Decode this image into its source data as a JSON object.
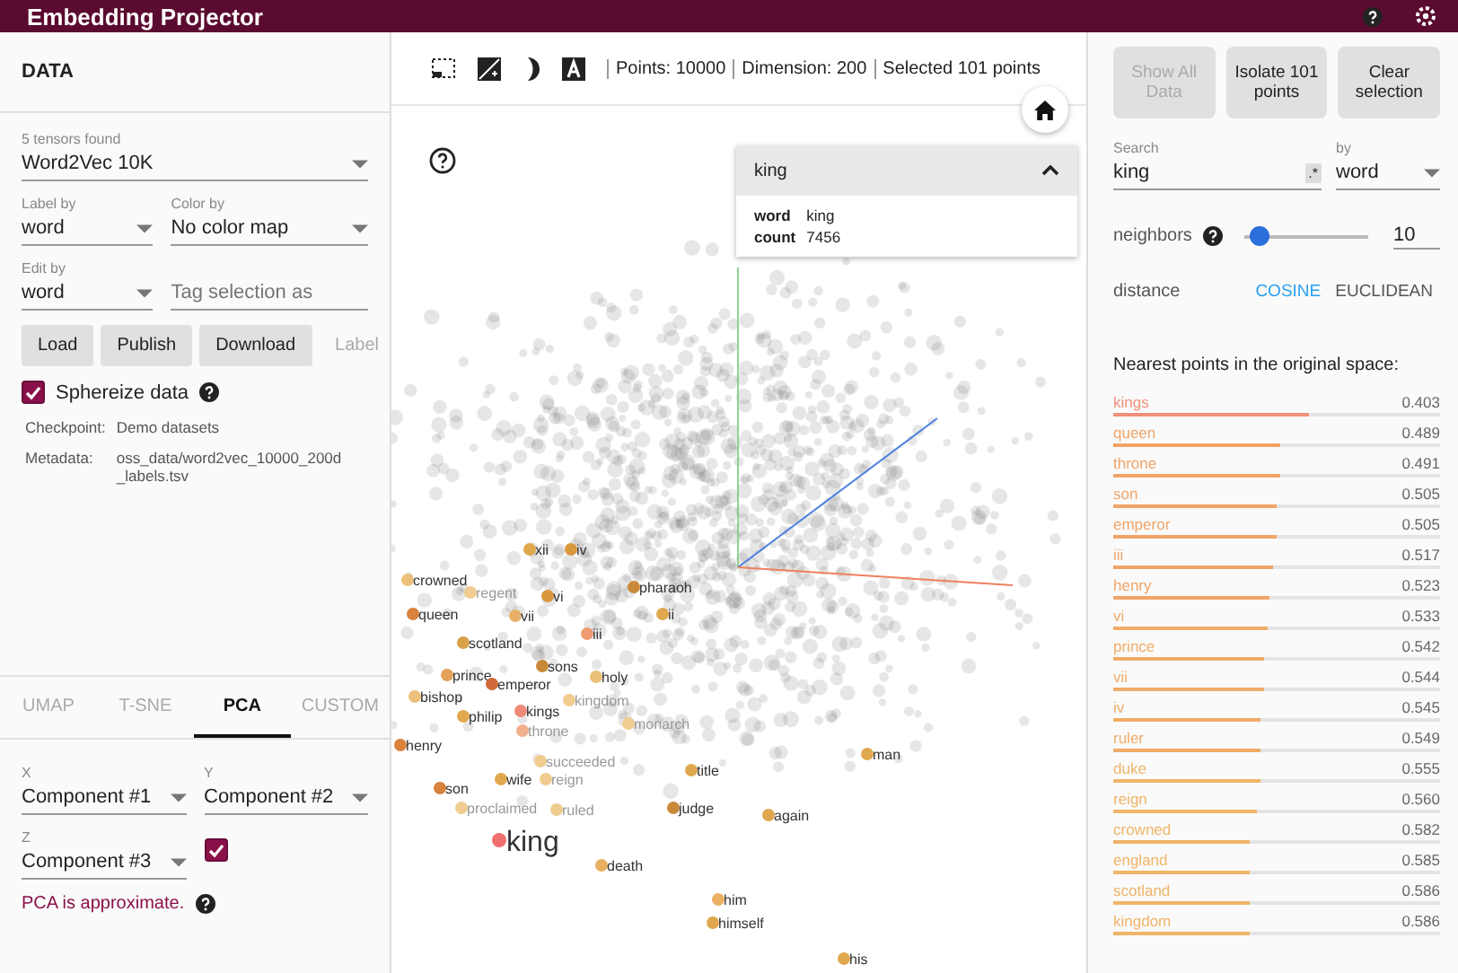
{
  "header": {
    "title": "Embedding Projector"
  },
  "data_panel": {
    "title": "DATA",
    "tensor_select": {
      "label": "5 tensors found",
      "value": "Word2Vec 10K"
    },
    "label_by": {
      "label": "Label by",
      "value": "word"
    },
    "color_by": {
      "label": "Color by",
      "value": "No color map"
    },
    "edit_by": {
      "label": "Edit by",
      "value": "word"
    },
    "tag_field": {
      "placeholder": "Tag selection as"
    },
    "buttons": [
      {
        "label": "Load",
        "disabled": false
      },
      {
        "label": "Publish",
        "disabled": false
      },
      {
        "label": "Download",
        "disabled": false
      },
      {
        "label": "Label",
        "disabled": true
      }
    ],
    "sphereize": {
      "label": "Sphereize data",
      "checked": true
    },
    "checkpoint": {
      "label": "Checkpoint:",
      "value": "Demo datasets"
    },
    "metadata": {
      "label": "Metadata:",
      "value": "oss_data/word2vec_10000_200d_labels.tsv"
    }
  },
  "projection_tabs": [
    {
      "label": "UMAP",
      "selected": false
    },
    {
      "label": "T-SNE",
      "selected": false
    },
    {
      "label": "PCA",
      "selected": true
    },
    {
      "label": "CUSTOM",
      "selected": false
    }
  ],
  "pca": {
    "x": {
      "label": "X",
      "value": "Component #1"
    },
    "y": {
      "label": "Y",
      "value": "Component #2"
    },
    "z": {
      "label": "Z",
      "value": "Component #3"
    },
    "z_enabled": {
      "checked": true
    },
    "note": "PCA is approximate."
  },
  "toolbar": {
    "stats": [
      "Points: 10000",
      "Dimension: 200",
      "Selected 101 points"
    ]
  },
  "inspector_card": {
    "title": "king",
    "expanded": true,
    "fields": [
      {
        "key": "word",
        "value": "king"
      },
      {
        "key": "count",
        "value": "7456"
      }
    ]
  },
  "points": [
    {
      "label": "xii",
      "color": "#e0a84e",
      "faded": false
    },
    {
      "label": "iv",
      "color": "#d9983e",
      "faded": false
    },
    {
      "label": "crowned",
      "color": "#ecc07a",
      "faded": false
    },
    {
      "label": "regent",
      "color": "#f0cc90",
      "faded": true
    },
    {
      "label": "vi",
      "color": "#d9983e",
      "faded": false
    },
    {
      "label": "pharaoh",
      "color": "#c88a3a",
      "faded": false
    },
    {
      "label": "queen",
      "color": "#d8823c",
      "faded": false
    },
    {
      "label": "vii",
      "color": "#e8b06a",
      "faded": false
    },
    {
      "label": "ii",
      "color": "#e0a84e",
      "faded": false
    },
    {
      "label": "iii",
      "color": "#ee9a70",
      "faded": false
    },
    {
      "label": "scotland",
      "color": "#d9a04a",
      "faded": false
    },
    {
      "label": "sons",
      "color": "#c88a3a",
      "faded": false
    },
    {
      "label": "prince",
      "color": "#e3a058",
      "faded": false
    },
    {
      "label": "holy",
      "color": "#ecc07a",
      "faded": false
    },
    {
      "label": "emperor",
      "color": "#d06a3a",
      "faded": false
    },
    {
      "label": "bishop",
      "color": "#ecc07a",
      "faded": false
    },
    {
      "label": "kingdom",
      "color": "#f0cc90",
      "faded": true
    },
    {
      "label": "kings",
      "color": "#f08a7a",
      "faded": false
    },
    {
      "label": "philip",
      "color": "#e3a84e",
      "faded": false
    },
    {
      "label": "monarch",
      "color": "#f0cc90",
      "faded": true
    },
    {
      "label": "throne",
      "color": "#f2b08e",
      "faded": true
    },
    {
      "label": "henry",
      "color": "#d8823c",
      "faded": false
    },
    {
      "label": "man",
      "color": "#e0a84e",
      "faded": false
    },
    {
      "label": "succeeded",
      "color": "#f0cc90",
      "faded": true
    },
    {
      "label": "title",
      "color": "#e0a84e",
      "faded": false
    },
    {
      "label": "wife",
      "color": "#e0a84e",
      "faded": false
    },
    {
      "label": "reign",
      "color": "#f0cc90",
      "faded": true
    },
    {
      "label": "son",
      "color": "#d8823c",
      "faded": false
    },
    {
      "label": "proclaimed",
      "color": "#f0cc90",
      "faded": true
    },
    {
      "label": "ruled",
      "color": "#f0cc90",
      "faded": true
    },
    {
      "label": "judge",
      "color": "#c88a3a",
      "faded": false
    },
    {
      "label": "again",
      "color": "#e0a84e",
      "faded": false
    },
    {
      "label": "king",
      "color": "#f07070",
      "faded": false
    },
    {
      "label": "death",
      "color": "#e8b060",
      "faded": false
    },
    {
      "label": "him",
      "color": "#e8b060",
      "faded": false
    },
    {
      "label": "himself",
      "color": "#e0a84e",
      "faded": false
    },
    {
      "label": "his",
      "color": "#e0a84e",
      "faded": false
    }
  ],
  "right_panel": {
    "buttons": [
      {
        "label": "Show All Data",
        "disabled": true
      },
      {
        "label": "Isolate 101 points",
        "disabled": false
      },
      {
        "label": "Clear selection",
        "disabled": false
      }
    ],
    "search": {
      "label": "Search",
      "value": "king",
      "regex": ".*"
    },
    "search_by": {
      "label": "by",
      "value": "word"
    },
    "neighbors": {
      "label": "neighbors",
      "level": 0.05,
      "value": "10"
    },
    "distance": {
      "label": "distance",
      "options": [
        {
          "label": "COSINE",
          "selected": true
        },
        {
          "label": "EUCLIDEAN",
          "selected": false
        }
      ]
    },
    "nearest_title": "Nearest points in the original space:",
    "nearest": [
      {
        "label": "kings",
        "value": "0.403",
        "level": 0.6,
        "color": "#f0907a"
      },
      {
        "label": "queen",
        "value": "0.489",
        "level": 0.51,
        "color": "#f0a468"
      },
      {
        "label": "throne",
        "value": "0.491",
        "level": 0.51,
        "color": "#f0a468"
      },
      {
        "label": "son",
        "value": "0.505",
        "level": 0.5,
        "color": "#f0a468"
      },
      {
        "label": "emperor",
        "value": "0.505",
        "level": 0.5,
        "color": "#f0a468"
      },
      {
        "label": "iii",
        "value": "0.517",
        "level": 0.49,
        "color": "#f0a468"
      },
      {
        "label": "henry",
        "value": "0.523",
        "level": 0.48,
        "color": "#f0a468"
      },
      {
        "label": "vi",
        "value": "0.533",
        "level": 0.47,
        "color": "#f0ac68"
      },
      {
        "label": "prince",
        "value": "0.542",
        "level": 0.46,
        "color": "#f0ac68"
      },
      {
        "label": "vii",
        "value": "0.544",
        "level": 0.46,
        "color": "#f0ac68"
      },
      {
        "label": "iv",
        "value": "0.545",
        "level": 0.45,
        "color": "#f0ac68"
      },
      {
        "label": "ruler",
        "value": "0.549",
        "level": 0.45,
        "color": "#f0ac68"
      },
      {
        "label": "duke",
        "value": "0.555",
        "level": 0.45,
        "color": "#f0b468"
      },
      {
        "label": "reign",
        "value": "0.560",
        "level": 0.44,
        "color": "#f0b468"
      },
      {
        "label": "crowned",
        "value": "0.582",
        "level": 0.42,
        "color": "#f0b468"
      },
      {
        "label": "england",
        "value": "0.585",
        "level": 0.42,
        "color": "#f0b468"
      },
      {
        "label": "scotland",
        "value": "0.586",
        "level": 0.42,
        "color": "#f0b468"
      },
      {
        "label": "kingdom",
        "value": "0.586",
        "level": 0.42,
        "color": "#f0b468"
      }
    ]
  }
}
